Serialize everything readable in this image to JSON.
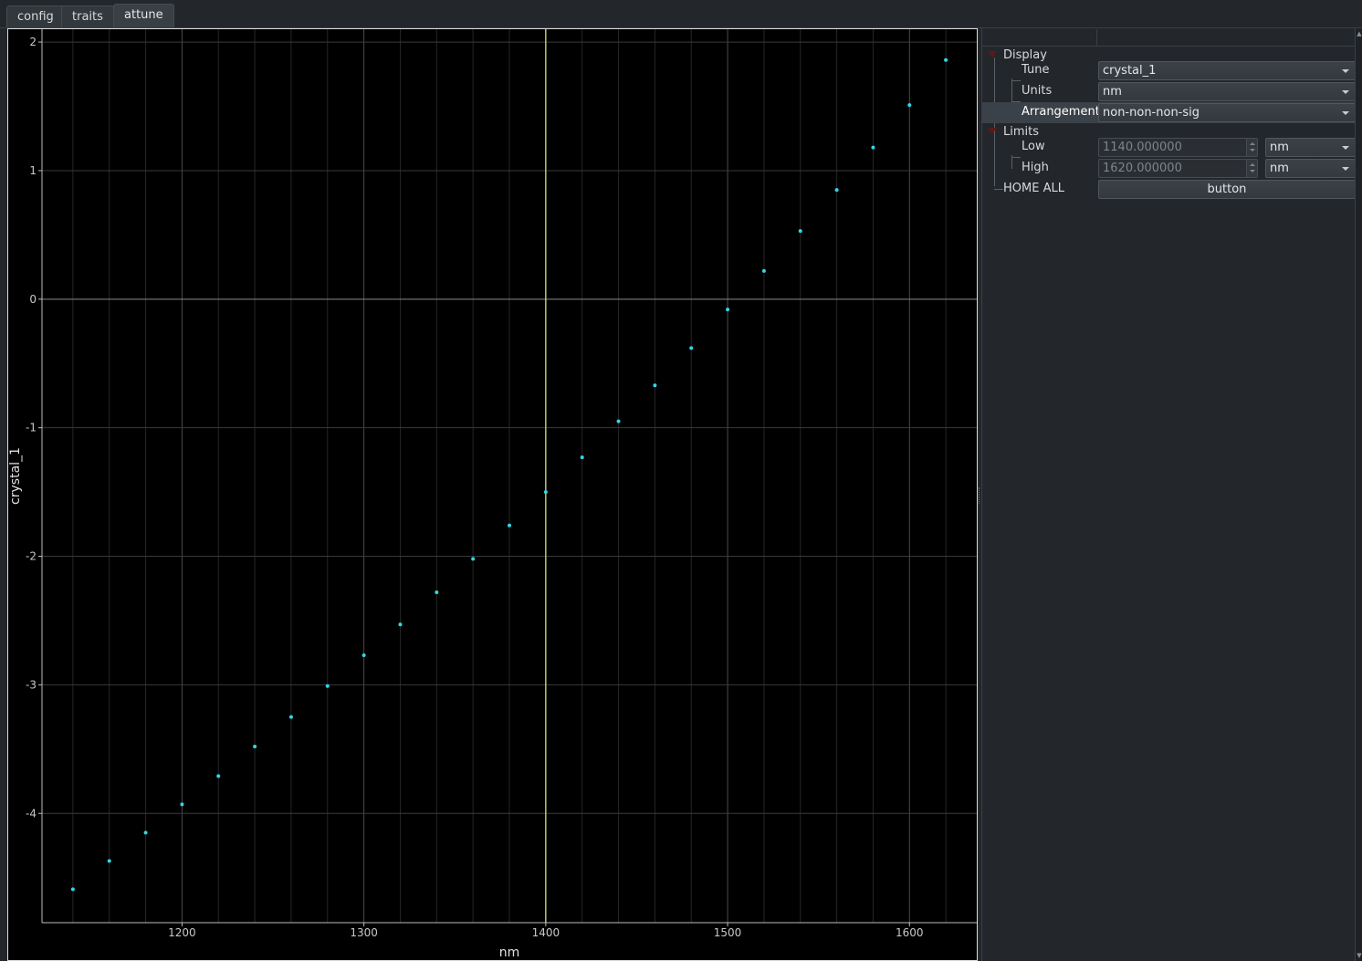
{
  "tabs": [
    {
      "label": "config",
      "active": false
    },
    {
      "label": "traits",
      "active": false
    },
    {
      "label": "attune",
      "active": true
    }
  ],
  "panel": {
    "display": {
      "label": "Display",
      "tune": {
        "label": "Tune",
        "value": "crystal_1"
      },
      "units": {
        "label": "Units",
        "value": "nm"
      },
      "arrangement": {
        "label": "Arrangement",
        "value": "non-non-non-sig"
      }
    },
    "limits": {
      "label": "Limits",
      "low": {
        "label": "Low",
        "value": "1140.000000",
        "unit": "nm"
      },
      "high": {
        "label": "High",
        "value": "1620.000000",
        "unit": "nm"
      }
    },
    "home_all": {
      "label": "HOME ALL",
      "button": "button"
    }
  },
  "chart_data": {
    "type": "scatter",
    "xlabel": "nm",
    "ylabel": "crystal_1",
    "xlim": [
      1123,
      1637
    ],
    "ylim": [
      -4.85,
      2.1
    ],
    "xticks": [
      1200,
      1300,
      1400,
      1500,
      1600
    ],
    "yticks": [
      -4,
      -3,
      -2,
      -1,
      0,
      1,
      2
    ],
    "grid": true,
    "marker_color": "#33d6e6",
    "highlight_x": 1400,
    "highlight_color": "#e8e88a",
    "series": [
      {
        "x": [
          1140,
          1160,
          1180,
          1200,
          1220,
          1240,
          1260,
          1280,
          1300,
          1320,
          1340,
          1360,
          1380,
          1400,
          1420,
          1440,
          1460,
          1480,
          1500,
          1520,
          1540,
          1560,
          1580,
          1600,
          1620
        ],
        "y": [
          -4.59,
          -4.37,
          -4.15,
          -3.93,
          -3.71,
          -3.48,
          -3.25,
          -3.01,
          -2.77,
          -2.53,
          -2.28,
          -2.02,
          -1.76,
          -1.5,
          -1.23,
          -0.95,
          -0.67,
          -0.38,
          -0.08,
          0.22,
          0.53,
          0.85,
          1.18,
          1.51,
          1.86
        ]
      }
    ]
  }
}
